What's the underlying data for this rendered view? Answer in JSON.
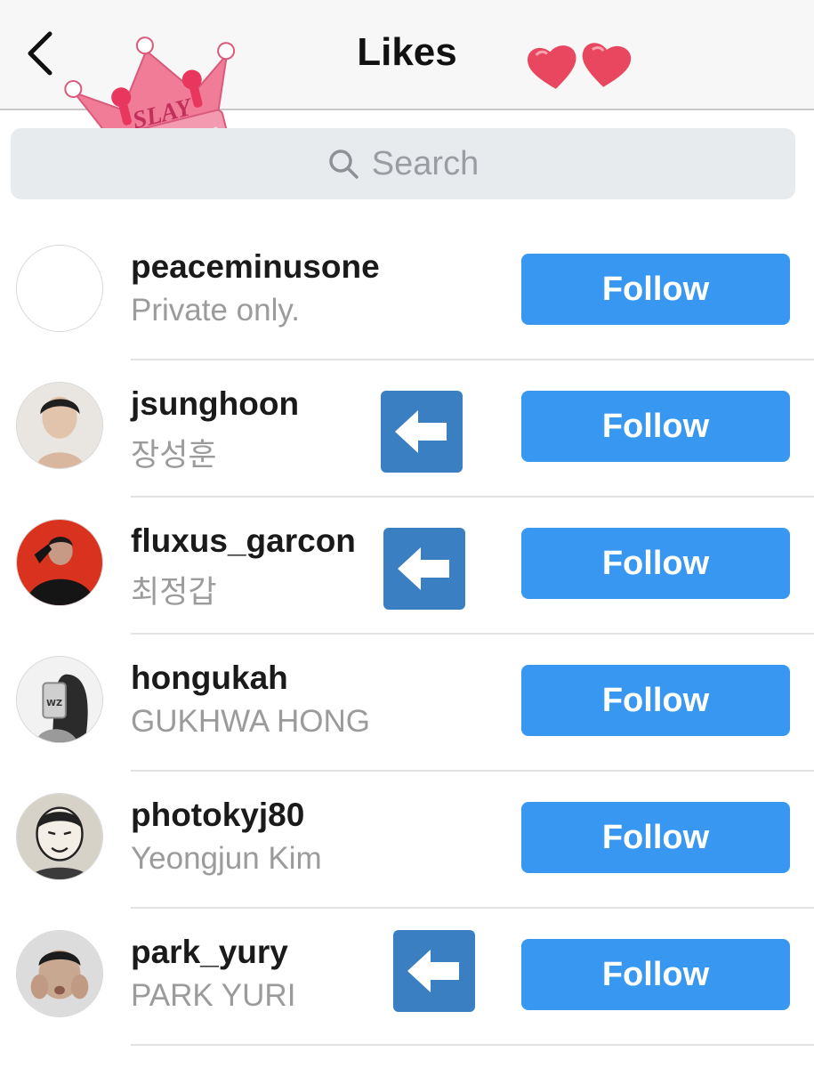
{
  "header": {
    "title": "Likes",
    "back_icon": "chevron-left-icon",
    "decorations": {
      "crown_text": "SLAY",
      "crown_color": "#f07c98",
      "heart_color": "#e8475f"
    }
  },
  "search": {
    "placeholder": "Search",
    "icon": "search-icon"
  },
  "users": [
    {
      "username": "peaceminusone",
      "full_name": "Private only.",
      "button": "Follow",
      "avatar": "empty"
    },
    {
      "username": "jsunghoon",
      "full_name": "장성훈",
      "button": "Follow",
      "avatar": "photo",
      "marked": true
    },
    {
      "username": "fluxus_garcon",
      "full_name": "최정갑",
      "button": "Follow",
      "avatar": "photo-red",
      "marked": true
    },
    {
      "username": "hongukah",
      "full_name": "GUKHWA HONG",
      "button": "Follow",
      "avatar": "photo-bw"
    },
    {
      "username": "photokyj80",
      "full_name": "Yeongjun Kim",
      "button": "Follow",
      "avatar": "illustration"
    },
    {
      "username": "park_yury",
      "full_name": "PARK YURI",
      "button": "Follow",
      "avatar": "photo",
      "marked": true
    }
  ],
  "colors": {
    "follow_button": "#3897f0",
    "arrow_badge": "#3a7fc2",
    "muted_text": "#9b9b9b"
  }
}
